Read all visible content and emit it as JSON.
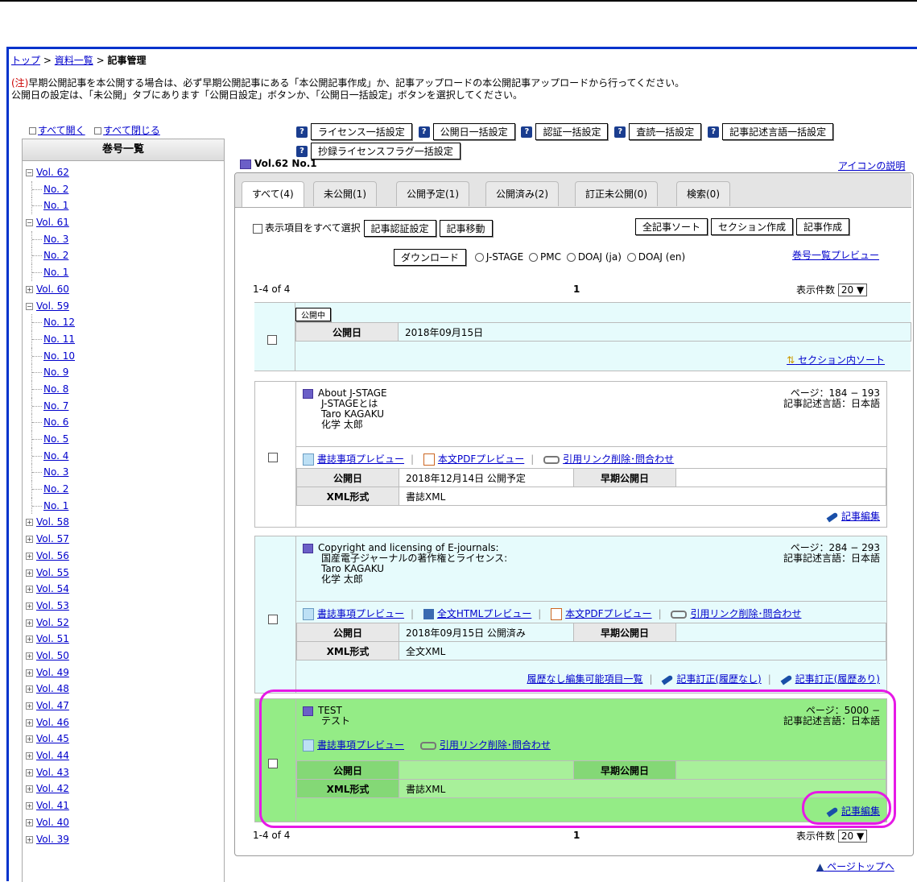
{
  "breadcrumb": {
    "top": "トップ",
    "list": "資料一覧",
    "current": "記事管理",
    "sep": ">"
  },
  "notice": {
    "prefix": "(注)",
    "line1": "早期公開記事を本公開する場合は、必ず早期公開記事にある「本公開記事作成」か、記事アップロードの本公開記事アップロードから行ってください。",
    "line2": "公開日の設定は、「未公開」タブにあります「公開日設定」ボタンか、「公開日一括設定」ボタンを選択してください。"
  },
  "tree_controls": {
    "open_all": "すべて開く",
    "close_all": "すべて閉じる"
  },
  "sidebar": {
    "title": "巻号一覧",
    "items": [
      {
        "label": "Vol. 62",
        "type": "vol",
        "state": "−"
      },
      {
        "label": "No. 2",
        "type": "no"
      },
      {
        "label": "No. 1",
        "type": "no"
      },
      {
        "label": "Vol. 61",
        "type": "vol",
        "state": "−"
      },
      {
        "label": "No. 3",
        "type": "no"
      },
      {
        "label": "No. 2",
        "type": "no"
      },
      {
        "label": "No. 1",
        "type": "no"
      },
      {
        "label": "Vol. 60",
        "type": "vol",
        "state": "+"
      },
      {
        "label": "Vol. 59",
        "type": "vol",
        "state": "−"
      },
      {
        "label": "No. 12",
        "type": "no"
      },
      {
        "label": "No. 11",
        "type": "no"
      },
      {
        "label": "No. 10",
        "type": "no"
      },
      {
        "label": "No. 9",
        "type": "no"
      },
      {
        "label": "No. 8",
        "type": "no"
      },
      {
        "label": "No. 7",
        "type": "no"
      },
      {
        "label": "No. 6",
        "type": "no"
      },
      {
        "label": "No. 5",
        "type": "no"
      },
      {
        "label": "No. 4",
        "type": "no"
      },
      {
        "label": "No. 3",
        "type": "no"
      },
      {
        "label": "No. 2",
        "type": "no"
      },
      {
        "label": "No. 1",
        "type": "no"
      },
      {
        "label": "Vol. 58",
        "type": "vol",
        "state": "+"
      },
      {
        "label": "Vol. 57",
        "type": "vol",
        "state": "+"
      },
      {
        "label": "Vol. 56",
        "type": "vol",
        "state": "+"
      },
      {
        "label": "Vol. 55",
        "type": "vol",
        "state": "+"
      },
      {
        "label": "Vol. 54",
        "type": "vol",
        "state": "+"
      },
      {
        "label": "Vol. 53",
        "type": "vol",
        "state": "+"
      },
      {
        "label": "Vol. 52",
        "type": "vol",
        "state": "+"
      },
      {
        "label": "Vol. 51",
        "type": "vol",
        "state": "+"
      },
      {
        "label": "Vol. 50",
        "type": "vol",
        "state": "+"
      },
      {
        "label": "Vol. 49",
        "type": "vol",
        "state": "+"
      },
      {
        "label": "Vol. 48",
        "type": "vol",
        "state": "+"
      },
      {
        "label": "Vol. 47",
        "type": "vol",
        "state": "+"
      },
      {
        "label": "Vol. 46",
        "type": "vol",
        "state": "+"
      },
      {
        "label": "Vol. 45",
        "type": "vol",
        "state": "+"
      },
      {
        "label": "Vol. 44",
        "type": "vol",
        "state": "+"
      },
      {
        "label": "Vol. 43",
        "type": "vol",
        "state": "+"
      },
      {
        "label": "Vol. 42",
        "type": "vol",
        "state": "+"
      },
      {
        "label": "Vol. 41",
        "type": "vol",
        "state": "+"
      },
      {
        "label": "Vol. 40",
        "type": "vol",
        "state": "+"
      },
      {
        "label": "Vol. 39",
        "type": "vol",
        "state": "+"
      }
    ]
  },
  "bulk_buttons": {
    "license": "ライセンス一括設定",
    "pubdate": "公開日一括設定",
    "auth": "認証一括設定",
    "review": "査読一括設定",
    "lang": "記事記述言語一括設定",
    "abstract_license": "抄録ライセンスフラグ一括設定",
    "help": "?"
  },
  "volume_heading": "Vol.62 No.1",
  "icon_legend": "アイコンの説明",
  "tabs": [
    "すべて(4)",
    "未公開(1)",
    "公開予定(1)",
    "公開済み(2)",
    "訂正未公開(0)",
    "検索(0)"
  ],
  "toolbar": {
    "select_all": "表示項目をすべて選択",
    "auth_setting": "記事認証設定",
    "move": "記事移動",
    "sort_all": "全記事ソート",
    "create_section": "セクション作成",
    "create_article": "記事作成",
    "download": "ダウンロード",
    "formats": [
      "J-STAGE",
      "PMC",
      "DOAJ (ja)",
      "DOAJ (en)"
    ],
    "vol_preview": "巻号一覧プレビュー"
  },
  "pager": {
    "range": "1-4 of 4",
    "page": "1",
    "per_page_label": "表示件数",
    "per_page": "20"
  },
  "section": {
    "badge": "公開中",
    "pubdate_label": "公開日",
    "pubdate": "2018年09月15日",
    "sort": "セクション内ソート"
  },
  "labels": {
    "pubdate": "公開日",
    "early": "早期公開日",
    "xml": "XML形式",
    "biblio_preview": "書誌事項プレビュー",
    "pdf_preview": "本文PDFプレビュー",
    "html_preview": "全文HTMLプレビュー",
    "cite": "引用リンク削除･問合わせ",
    "edit": "記事編集",
    "editable_list": "履歴なし編集可能項目一覧",
    "correct_no_hist": "記事訂正(履歴なし)",
    "correct_hist": "記事訂正(履歴あり)"
  },
  "articles": [
    {
      "title_en": "About J-STAGE",
      "title_ja": "J-STAGEとは",
      "author_en": "Taro KAGAKU",
      "author_ja": "化学 太郎",
      "pages": "ページ：184 − 193",
      "lang": "記事記述言語：日本語",
      "pubdate": "2018年12月14日 公開予定",
      "xml": "書誌XML"
    },
    {
      "title_en": "Copyright and licensing of E-journals:",
      "title_ja": "国産電子ジャーナルの著作権とライセンス:",
      "author_en": "Taro KAGAKU",
      "author_ja": "化学 太郎",
      "pages": "ページ：284 − 293",
      "lang": "記事記述言語：日本語",
      "pubdate": "2018年09月15日 公開済み",
      "xml": "全文XML"
    },
    {
      "title_en": "TEST",
      "title_ja": "テスト",
      "pages": "ページ：5000 −",
      "lang": "記事記述言語：日本語",
      "pubdate": "",
      "xml": "書誌XML"
    }
  ],
  "page_top": "ページトップへ",
  "colors": {
    "accent_blue": "#0033cc",
    "highlight_magenta": "#e619e6",
    "card_cyan": "#e6fbfc",
    "card_green": "#94ec86"
  }
}
